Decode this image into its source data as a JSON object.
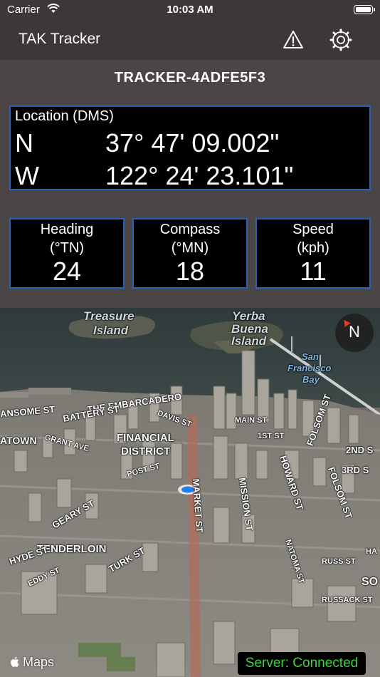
{
  "status_bar": {
    "carrier": "Carrier",
    "time": "10:03 AM"
  },
  "nav": {
    "title": "TAK Tracker",
    "warning_icon": "warning-triangle-icon",
    "settings_icon": "gear-icon"
  },
  "tracker_id": "TRACKER-4ADFE5F3",
  "location": {
    "title": "Location (DMS)",
    "lat_hemisphere": "N",
    "lat_value": "37° 47' 09.002\"",
    "lon_hemisphere": "W",
    "lon_value": "122° 24' 23.101\""
  },
  "metrics": {
    "heading": {
      "label": "Heading",
      "unit": "(°TN)",
      "value": "24"
    },
    "compass": {
      "label": "Compass",
      "unit": "(°MN)",
      "value": "18"
    },
    "speed": {
      "label": "Speed",
      "unit": "(kph)",
      "value": "11"
    }
  },
  "map": {
    "labels": {
      "treasure": "Treasure",
      "island": "Island",
      "yerba": "Yerba",
      "buena": "Buena",
      "island2": "Island",
      "san": "San",
      "francisco": "Francisco",
      "bay": "Bay",
      "embarcadero": "THE EMBARCADERO",
      "battery": "BATTERY ST",
      "sansome": "ANSOME ST",
      "davis": "DAVIS ST",
      "financial": "FINANCIAL",
      "district": "DISTRICT",
      "atown": "ATOWN",
      "grant": "GRANT AVE",
      "main": "MAIN ST",
      "first": "1ST ST",
      "folsom": "FOLSOM ST",
      "second": "2ND S",
      "third": "3RD S",
      "post": "POST ST",
      "market": "MARKET ST",
      "mission": "MISSION ST",
      "howard": "HOWARD ST",
      "folsom2": "FOLSOM ST",
      "geary": "GEARY ST",
      "tenderloin": "TENDERLOIN",
      "hyde": "HYDE ST",
      "turk": "TURK ST",
      "eddy": "EDDY ST",
      "natoma": "NATOMA ST",
      "russ": "RUSS ST",
      "russ2": "RUSSACK ST",
      "soma": "SO",
      "ha": "HA"
    },
    "compass_letter": "N",
    "attribution": "Maps",
    "server_status": "Server: Connected"
  },
  "colors": {
    "panel_border": "#2d5fb4",
    "server_text": "#3ed23e",
    "background": "#4a4645"
  }
}
